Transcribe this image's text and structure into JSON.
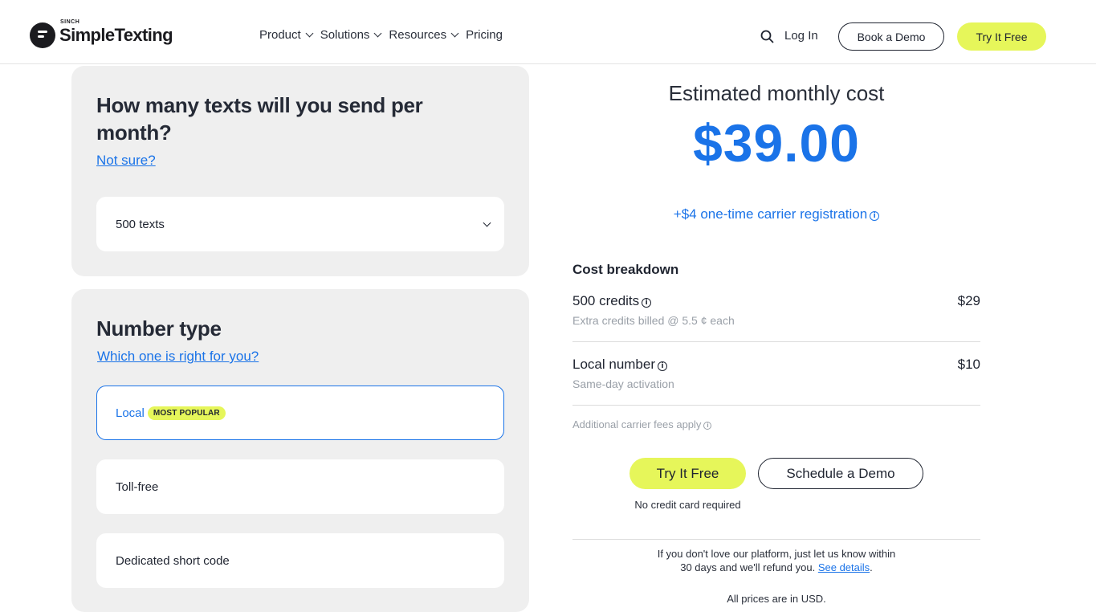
{
  "header": {
    "logo_top": "SINCH",
    "logo_name": "SimpleTexting",
    "nav": [
      {
        "label": "Product",
        "has_dropdown": true
      },
      {
        "label": "Solutions",
        "has_dropdown": true
      },
      {
        "label": "Resources",
        "has_dropdown": true
      },
      {
        "label": "Pricing",
        "has_dropdown": false
      }
    ],
    "login_label": "Log In",
    "book_demo_label": "Book a Demo",
    "try_free_label": "Try It Free"
  },
  "texts_card": {
    "title": "How many texts will you send per month?",
    "help_link": "Not sure?",
    "selected_volume": "500 texts"
  },
  "number_card": {
    "title": "Number type",
    "help_link": "Which one is right for you?",
    "options": [
      {
        "label": "Local",
        "badge": "MOST POPULAR",
        "selected": true
      },
      {
        "label": "Toll-free",
        "selected": false
      },
      {
        "label": "Dedicated short code",
        "selected": false
      }
    ]
  },
  "estimate": {
    "title": "Estimated monthly cost",
    "price": "$39.00",
    "carrier_note": "+$4 one-time carrier registration"
  },
  "breakdown": {
    "title": "Cost breakdown",
    "rows": [
      {
        "label": "500 credits",
        "sub": "Extra credits billed @ 5.5 ¢ each",
        "amount": "$29"
      },
      {
        "label": "Local number",
        "sub": "Same-day activation",
        "amount": "$10"
      }
    ],
    "fees_note": "Additional carrier fees apply"
  },
  "cta": {
    "try_free_label": "Try It Free",
    "schedule_demo_label": "Schedule a Demo",
    "no_card_note": "No credit card required"
  },
  "footer": {
    "refund_line1": "If you don't love our platform, just let us know within",
    "refund_line2": "30 days and we'll refund you.",
    "refund_link": "See details",
    "refund_end": ".",
    "currency_note": "All prices are in USD."
  },
  "colors": {
    "accent_blue": "#1a73e8",
    "accent_yellow": "#e6f65a",
    "card_bg": "#efefef"
  }
}
